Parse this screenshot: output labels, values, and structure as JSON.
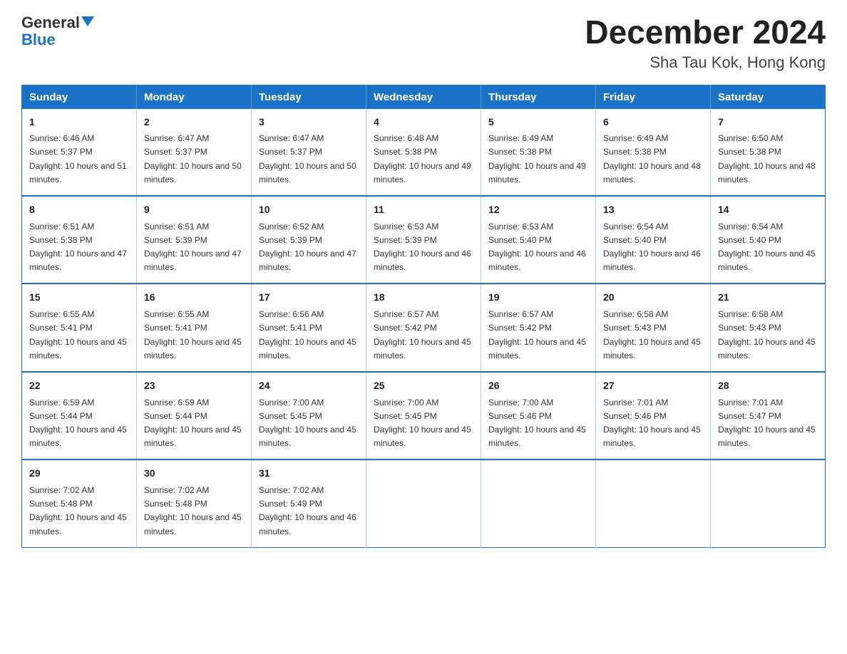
{
  "logo": {
    "general": "General",
    "blue": "Blue"
  },
  "header": {
    "month_year": "December 2024",
    "location": "Sha Tau Kok, Hong Kong"
  },
  "days_of_week": [
    "Sunday",
    "Monday",
    "Tuesday",
    "Wednesday",
    "Thursday",
    "Friday",
    "Saturday"
  ],
  "weeks": [
    [
      {
        "day": "1",
        "sunrise": "6:46 AM",
        "sunset": "5:37 PM",
        "daylight": "10 hours and 51 minutes."
      },
      {
        "day": "2",
        "sunrise": "6:47 AM",
        "sunset": "5:37 PM",
        "daylight": "10 hours and 50 minutes."
      },
      {
        "day": "3",
        "sunrise": "6:47 AM",
        "sunset": "5:37 PM",
        "daylight": "10 hours and 50 minutes."
      },
      {
        "day": "4",
        "sunrise": "6:48 AM",
        "sunset": "5:38 PM",
        "daylight": "10 hours and 49 minutes."
      },
      {
        "day": "5",
        "sunrise": "6:49 AM",
        "sunset": "5:38 PM",
        "daylight": "10 hours and 49 minutes."
      },
      {
        "day": "6",
        "sunrise": "6:49 AM",
        "sunset": "5:38 PM",
        "daylight": "10 hours and 48 minutes."
      },
      {
        "day": "7",
        "sunrise": "6:50 AM",
        "sunset": "5:38 PM",
        "daylight": "10 hours and 48 minutes."
      }
    ],
    [
      {
        "day": "8",
        "sunrise": "6:51 AM",
        "sunset": "5:38 PM",
        "daylight": "10 hours and 47 minutes."
      },
      {
        "day": "9",
        "sunrise": "6:51 AM",
        "sunset": "5:39 PM",
        "daylight": "10 hours and 47 minutes."
      },
      {
        "day": "10",
        "sunrise": "6:52 AM",
        "sunset": "5:39 PM",
        "daylight": "10 hours and 47 minutes."
      },
      {
        "day": "11",
        "sunrise": "6:53 AM",
        "sunset": "5:39 PM",
        "daylight": "10 hours and 46 minutes."
      },
      {
        "day": "12",
        "sunrise": "6:53 AM",
        "sunset": "5:40 PM",
        "daylight": "10 hours and 46 minutes."
      },
      {
        "day": "13",
        "sunrise": "6:54 AM",
        "sunset": "5:40 PM",
        "daylight": "10 hours and 46 minutes."
      },
      {
        "day": "14",
        "sunrise": "6:54 AM",
        "sunset": "5:40 PM",
        "daylight": "10 hours and 45 minutes."
      }
    ],
    [
      {
        "day": "15",
        "sunrise": "6:55 AM",
        "sunset": "5:41 PM",
        "daylight": "10 hours and 45 minutes."
      },
      {
        "day": "16",
        "sunrise": "6:55 AM",
        "sunset": "5:41 PM",
        "daylight": "10 hours and 45 minutes."
      },
      {
        "day": "17",
        "sunrise": "6:56 AM",
        "sunset": "5:41 PM",
        "daylight": "10 hours and 45 minutes."
      },
      {
        "day": "18",
        "sunrise": "6:57 AM",
        "sunset": "5:42 PM",
        "daylight": "10 hours and 45 minutes."
      },
      {
        "day": "19",
        "sunrise": "6:57 AM",
        "sunset": "5:42 PM",
        "daylight": "10 hours and 45 minutes."
      },
      {
        "day": "20",
        "sunrise": "6:58 AM",
        "sunset": "5:43 PM",
        "daylight": "10 hours and 45 minutes."
      },
      {
        "day": "21",
        "sunrise": "6:58 AM",
        "sunset": "5:43 PM",
        "daylight": "10 hours and 45 minutes."
      }
    ],
    [
      {
        "day": "22",
        "sunrise": "6:59 AM",
        "sunset": "5:44 PM",
        "daylight": "10 hours and 45 minutes."
      },
      {
        "day": "23",
        "sunrise": "6:59 AM",
        "sunset": "5:44 PM",
        "daylight": "10 hours and 45 minutes."
      },
      {
        "day": "24",
        "sunrise": "7:00 AM",
        "sunset": "5:45 PM",
        "daylight": "10 hours and 45 minutes."
      },
      {
        "day": "25",
        "sunrise": "7:00 AM",
        "sunset": "5:45 PM",
        "daylight": "10 hours and 45 minutes."
      },
      {
        "day": "26",
        "sunrise": "7:00 AM",
        "sunset": "5:46 PM",
        "daylight": "10 hours and 45 minutes."
      },
      {
        "day": "27",
        "sunrise": "7:01 AM",
        "sunset": "5:46 PM",
        "daylight": "10 hours and 45 minutes."
      },
      {
        "day": "28",
        "sunrise": "7:01 AM",
        "sunset": "5:47 PM",
        "daylight": "10 hours and 45 minutes."
      }
    ],
    [
      {
        "day": "29",
        "sunrise": "7:02 AM",
        "sunset": "5:48 PM",
        "daylight": "10 hours and 45 minutes."
      },
      {
        "day": "30",
        "sunrise": "7:02 AM",
        "sunset": "5:48 PM",
        "daylight": "10 hours and 45 minutes."
      },
      {
        "day": "31",
        "sunrise": "7:02 AM",
        "sunset": "5:49 PM",
        "daylight": "10 hours and 46 minutes."
      },
      null,
      null,
      null,
      null
    ]
  ]
}
